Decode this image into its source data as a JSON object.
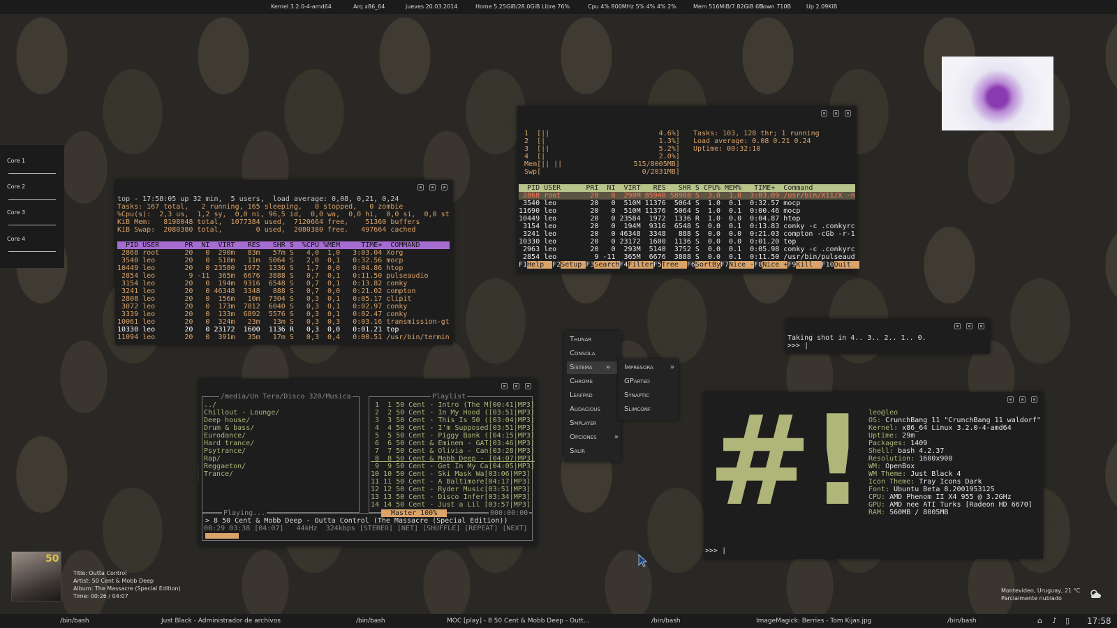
{
  "topbar": {
    "kernel": "Kernel 3.2.0-4-amd64",
    "arch": "Arq x86_64",
    "date": "jueves 20.03.2014",
    "home": "Home 5.25GiB/28.0GiB Libre 76%",
    "cpu": "Cpu 4% 800MHz 5% 4% 4% 2%",
    "mem": "Mem 516MiB/7.82GiB 6%",
    "down": "Down 710B",
    "up": "Up 2.09KiB"
  },
  "cores": [
    "Core 1",
    "Core 2",
    "Core 3",
    "Core 4"
  ],
  "top_term": {
    "lines": [
      "top - 17:58:05 up 32 min,  5 users,  load average: 0,08, 0,21, 0,24",
      "Tasks: 167 total,   2 running, 165 sleeping,   0 stopped,   0 zombie",
      "%Cpu(s):  2,3 us,  1,2 sy,  0,0 ni, 96,5 id,  0,0 wa,  0,0 hi,  0,0 si,  0,0 st",
      "KiB Mem:   8198048 total,  1077384 used,  7120664 free,    51360 buffers",
      "KiB Swap:  2080380 total,        0 used,  2080380 free.   497664 cached"
    ],
    "header": "  PID USER      PR  NI  VIRT   RES   SHR S  %CPU %MEM     TIME+  COMMAND",
    "rows": [
      " 2868 root      20   0  290m   83m   57m S   4,0  1,0   3:03.04 Xorg",
      " 3540 leo       20   0  510m   11m  5064 S   2,0  0,1   0:32.56 mocp",
      "10449 leo       20   0 23580  1972  1336 S   1,7  0,0   0:04.86 htop",
      " 2854 leo        9 -11  365m  6676  3888 S   0,7  0,1   0:11.50 pulseaudio",
      " 3154 leo       20   0  194m  9316  6548 S   0,7  0,1   0:13.82 conky",
      " 3241 leo       20   0 46348  3348   888 S   0,7  0,0   0:21.02 compton",
      " 2808 leo       20   0  156m   10m  7304 S   0,3  0,1   0:05.17 clipit",
      " 3072 leo       20   0  173m  7812  6040 S   0,3  0,1   0:02.97 conky",
      " 3339 leo       20   0  133m  6892  5576 S   0,3  0,1   0:02.47 conky",
      "10061 leo       20   0  324m   23m   13m S   0,3  0,3   0:03.16 transmission-gt",
      "10330 leo       20   0 23172  1600  1136 R   0,3  0,0   0:01.21 top",
      "11094 leo       20   0  391m   35m   17m S   0,3  0,4   0:00.51 /usr/bin/termin"
    ]
  },
  "htop": {
    "meters": [
      " 1  [||                          4.6%]",
      " 2  [|                           1.3%]",
      " 3  [||                          5.2%]",
      " 4  [|                           2.0%]",
      " Mem[|| ||                 515/8005MB]",
      " Swp[                        0/2031MB]"
    ],
    "info": [
      "Tasks: 103, 128 thr; 1 running",
      "Load average: 0.08 0.21 0.24",
      "Uptime: 00:32:10"
    ],
    "header": "  PID USER      PRI  NI  VIRT   RES   SHR S CPU% MEM%   TIME+  Command",
    "selected": " 2868 root       20   0  290M 85940 58988 S  3.0  1.0  3:03.09 /usr/bin/X11/X -n",
    "rows": [
      " 3540 leo        20   0  510M 11376  5064 S  1.0  0.1  0:32.57 mocp",
      "11690 leo        20   0  510M 11376  5064 S  1.0  0.1  0:00.46 mocp",
      "10449 leo        20   0 23584  1972  1336 R  1.0  0.0  0:04.87 htop",
      " 3154 leo        20   0  194M  9316  6548 S  0.0  0.1  0:13.83 conky -c .conkyrc",
      " 3241 leo        20   0 46348  3348   888 S  0.0  0.0  0:21.03 compton -cGb -r-1",
      "10330 leo        20   0 23172  1600  1136 S  0.0  0.0  0:01.20 top",
      " 2963 leo        20   0  293M  5140  3752 S  0.0  0.1  0:05.98 conky -c .conkyrc",
      " 2854 leo         9 -11  365M  6676  3888 S  0.0  0.1  0:11.50 /usr/bin/pulseaud"
    ],
    "fkeys": [
      {
        "k": "F1",
        "l": "Help"
      },
      {
        "k": "F2",
        "l": "Setup"
      },
      {
        "k": "F3",
        "l": "Search"
      },
      {
        "k": "F4",
        "l": "Filter"
      },
      {
        "k": "F5",
        "l": "Tree"
      },
      {
        "k": "F6",
        "l": "SortBy"
      },
      {
        "k": "F7",
        "l": "Nice -"
      },
      {
        "k": "F8",
        "l": "Nice +"
      },
      {
        "k": "F9",
        "l": "Kill"
      },
      {
        "k": "F10",
        "l": "Quit"
      }
    ]
  },
  "shot_term": {
    "line1": "Taking shot in 4.. 3.. 2.. 1.. 0.",
    "prompt": ">>> |"
  },
  "menu": {
    "items": [
      "Thunar",
      "Consola",
      "Sistema",
      "Chrome",
      "Leafpad",
      "Audacious",
      "Smplayer",
      "Opciones",
      "Salir"
    ],
    "submenu": [
      "Impresora",
      "GParted",
      "Synaptic",
      "Slimconf"
    ]
  },
  "moc": {
    "dir_title": "/media/Un Tera/Disco 320/Musica",
    "dirs": [
      "../",
      "Chillout - Lounge/",
      "Deep house/",
      "Drum & bass/",
      "Eurodance/",
      "Hard trance/",
      "Psytrance/",
      "Rap/",
      "Reggaeton/",
      "Trance/"
    ],
    "playlist_title": "Playlist",
    "playlist": [
      " 1  1 50 Cent - Intro (The M[00:41|MP3]",
      " 2  2 50 Cent - In My Hood ([03:51|MP3]",
      " 3  3 50 Cent - This Is 50 ([03:04|MP3]",
      " 4  4 50 Cent - I'm Supposed[03:51|MP3]",
      " 5  5 50 Cent - Piggy Bank ([04:15|MP3]",
      " 6  6 50 Cent & Eminem - GAT[03:46|MP3]",
      " 7  7 50 Cent & Olivia - Can[03:28|MP3]",
      " 8  8 50 Cent & Mobb Deep - [04:07|MP3]",
      " 9  9 50 Cent - Get In My Ca[04:05|MP3]",
      "10 10 50 Cent - Ski Mask Wa[03:06|MP3]",
      "11 11 50 Cent - A Baltimore[04:17|MP3]",
      "12 12 50 Cent - Ryder Music[03:51|MP3]",
      "13 13 50 Cent - Disco Infer[03:34|MP3]",
      "14 14 50 Cent - Just a Lil [03:57|MP3]"
    ],
    "playing_label": "Playing...",
    "master": "Master 100%",
    "counter": "000:00:00",
    "now": "> 8 50 Cent & Mobb Deep - Outta Control (The Massacre (Special Edition))",
    "status": "00:29 03:38 [04:07]   44kHz  324kbps [STEREO] [NET] [SHUFFLE] [REPEAT] [NEXT]"
  },
  "screenfetch": {
    "logo": "#!",
    "user": "leo@leo",
    "info": [
      {
        "k": "OS:",
        "v": "CrunchBang 11 \"CrunchBang 11 waldorf\""
      },
      {
        "k": "Kernel:",
        "v": "x86_64 Linux 3.2.0-4-amd64"
      },
      {
        "k": "Uptime:",
        "v": "29m"
      },
      {
        "k": "Packages:",
        "v": "1409"
      },
      {
        "k": "Shell:",
        "v": "bash 4.2.37"
      },
      {
        "k": "Resolution:",
        "v": "1600x900"
      },
      {
        "k": "WM:",
        "v": "OpenBox"
      },
      {
        "k": "WM Theme:",
        "v": "Just Black 4"
      },
      {
        "k": "Icon Theme:",
        "v": "Tray Icons Dark"
      },
      {
        "k": "Font:",
        "v": "Ubuntu Beta 8.2001953125"
      },
      {
        "k": "CPU:",
        "v": "AMD Phenom II X4 955 @ 3.2GHz"
      },
      {
        "k": "GPU:",
        "v": "AMD nee ATI Turks [Radeon HD 6670]"
      },
      {
        "k": "RAM:",
        "v": "560MB / 8005MB"
      }
    ],
    "prompt": ">>> |"
  },
  "nowplaying": {
    "title": "Title: Outta Control",
    "artist": "Artist: 50 Cent & Mobb Deep",
    "album": "Album: The Massacre (Special Edition)",
    "time": "Time: 00:26 / 04:07",
    "cover_text": "50"
  },
  "weather": {
    "location": "Montevideo, Uruguay, 21 °C",
    "condition": "Parcialmente nublado"
  },
  "taskbar": {
    "items": [
      "/bin/bash",
      "Just Black - Administrador de archivos",
      "/bin/bash",
      "MOC [play] - 8 50 Cent & Mobb Deep - Outt...",
      "/bin/bash",
      "ImageMagick: Berries - Tom Kijas.jpg",
      "/bin/bash"
    ],
    "clock": "17:58"
  },
  "colors": {
    "accent_green": "#b8c38a",
    "accent_orange": "#d9a36a",
    "purple_bar": "#a56cd1"
  }
}
